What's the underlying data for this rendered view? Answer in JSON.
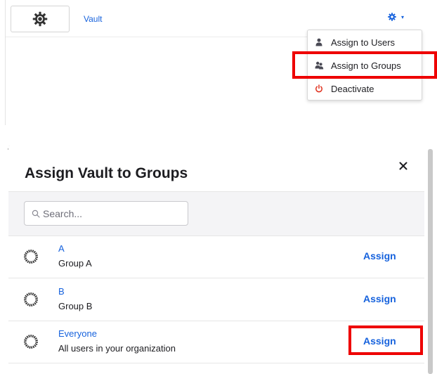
{
  "app_row": {
    "app_name": "Vault",
    "logo_icon": "gear-logo-icon",
    "settings_icon": "gear-icon",
    "caret": "▾"
  },
  "dropdown": {
    "items": [
      {
        "label": "Assign to Users",
        "icon": "user-icon"
      },
      {
        "label": "Assign to Groups",
        "icon": "group-icon"
      },
      {
        "label": "Deactivate",
        "icon": "power-icon",
        "icon_color": "#e0311e"
      }
    ]
  },
  "modal": {
    "title": "Assign Vault to Groups",
    "close_icon": "close-icon",
    "search": {
      "placeholder": "Search...",
      "value": ""
    },
    "groups": [
      {
        "name": "A",
        "description": "Group A",
        "action": "Assign"
      },
      {
        "name": "B",
        "description": "Group B",
        "action": "Assign"
      },
      {
        "name": "Everyone",
        "description": "All users in your organization",
        "action": "Assign"
      }
    ]
  },
  "colors": {
    "link": "#1662dd",
    "highlight": "#ee0000",
    "danger": "#e0311e"
  }
}
